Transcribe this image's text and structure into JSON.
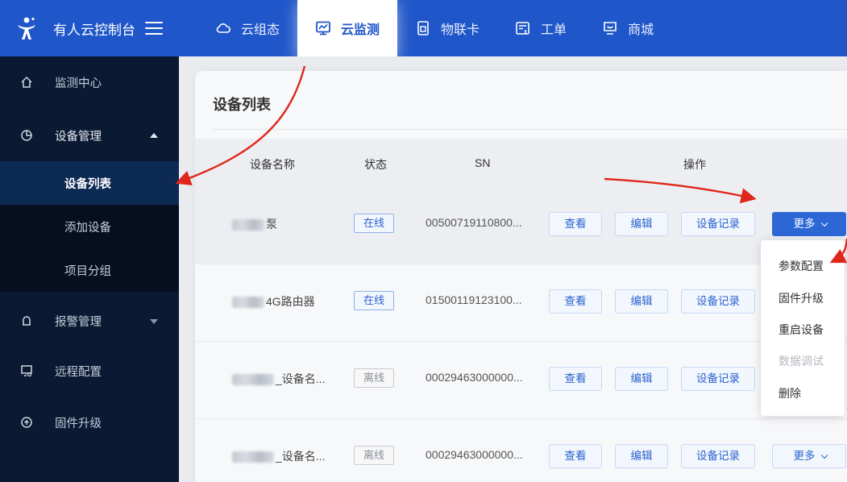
{
  "brand": {
    "title": "有人云控制台"
  },
  "nav": [
    {
      "label": "云组态",
      "icon": "cloud-icon"
    },
    {
      "label": "云监测",
      "icon": "monitor-icon",
      "active": true
    },
    {
      "label": "物联卡",
      "icon": "sim-card-icon"
    },
    {
      "label": "工单",
      "icon": "ticket-icon"
    },
    {
      "label": "商城",
      "icon": "shop-icon"
    }
  ],
  "sidebar": {
    "monitor_center": "监测中心",
    "device_mgmt": "设备管理",
    "device_list": "设备列表",
    "add_device": "添加设备",
    "project_group": "项目分组",
    "alarm_mgmt": "报警管理",
    "remote_config": "远程配置",
    "firmware_upgrade": "固件升级"
  },
  "page": {
    "title": "设备列表",
    "columns": {
      "name": "设备名称",
      "status": "状态",
      "sn": "SN",
      "ops": "操作"
    }
  },
  "rows": [
    {
      "name_suffix": "泵",
      "status": "在线",
      "online": true,
      "sn": "00500719110800..."
    },
    {
      "name_suffix": "4G路由器",
      "status": "在线",
      "online": true,
      "sn": "01500119123100..."
    },
    {
      "name_suffix": "_设备名...",
      "status": "离线",
      "online": false,
      "sn": "00029463000000..."
    },
    {
      "name_suffix": "_设备名...",
      "status": "离线",
      "online": false,
      "sn": "00029463000000..."
    }
  ],
  "actions": {
    "view": "查看",
    "edit": "编辑",
    "record": "设备记录",
    "more": "更多"
  },
  "dropdown": [
    {
      "label": "参数配置",
      "disabled": false
    },
    {
      "label": "固件升级",
      "disabled": false
    },
    {
      "label": "重启设备",
      "disabled": false
    },
    {
      "label": "数据调试",
      "disabled": true
    },
    {
      "label": "删除",
      "disabled": false
    }
  ],
  "colors": {
    "primary": "#1f56c9",
    "sidebar": "#0a1a33",
    "arrow": "#e0251b"
  }
}
